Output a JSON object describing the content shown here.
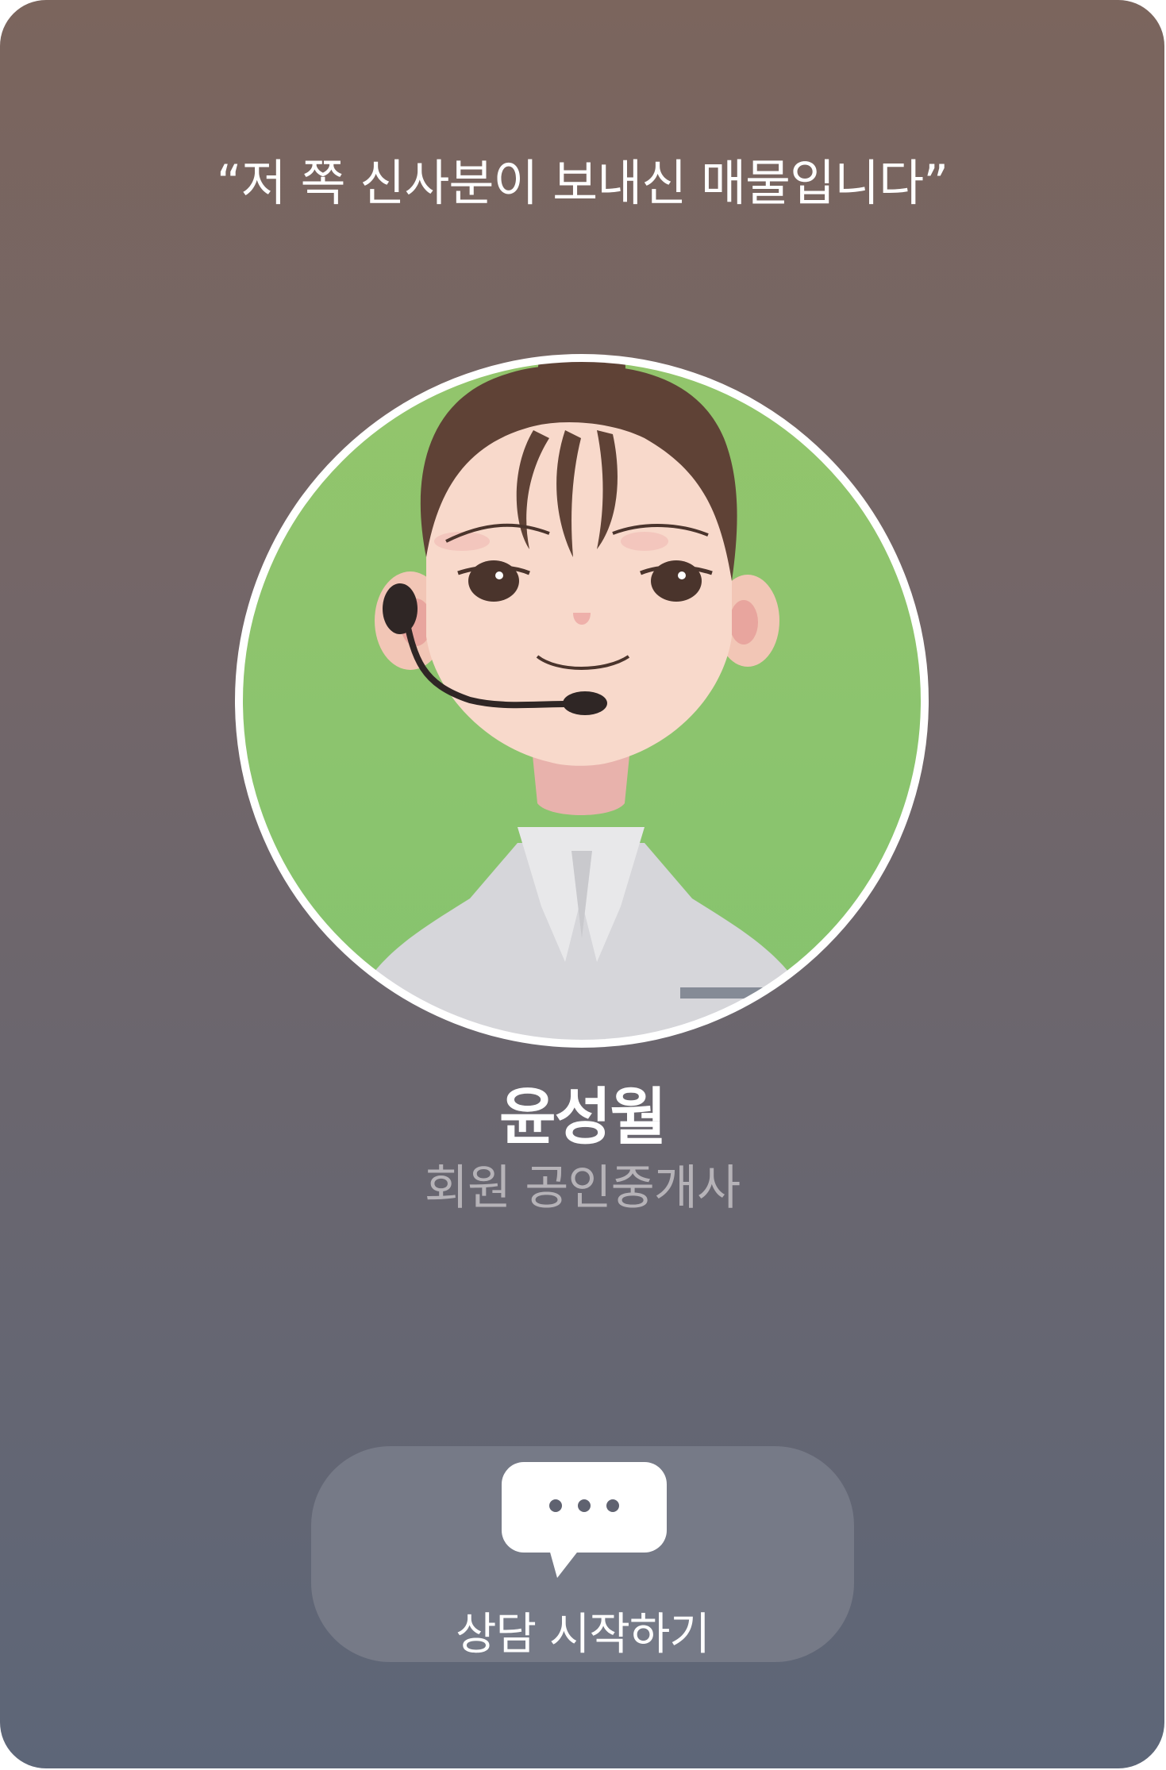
{
  "header": {
    "quote": "“저 쪽 신사분이 보내신 매물입니다”"
  },
  "agent": {
    "name": "윤성월",
    "role": "회원 공인중개사"
  },
  "action": {
    "label": "상담 시작하기",
    "icon": "chat-bubble-icon"
  },
  "colors": {
    "avatar_background": "#8dc46d",
    "button_background": "#767a87",
    "role_text": "#b6b3b8"
  }
}
